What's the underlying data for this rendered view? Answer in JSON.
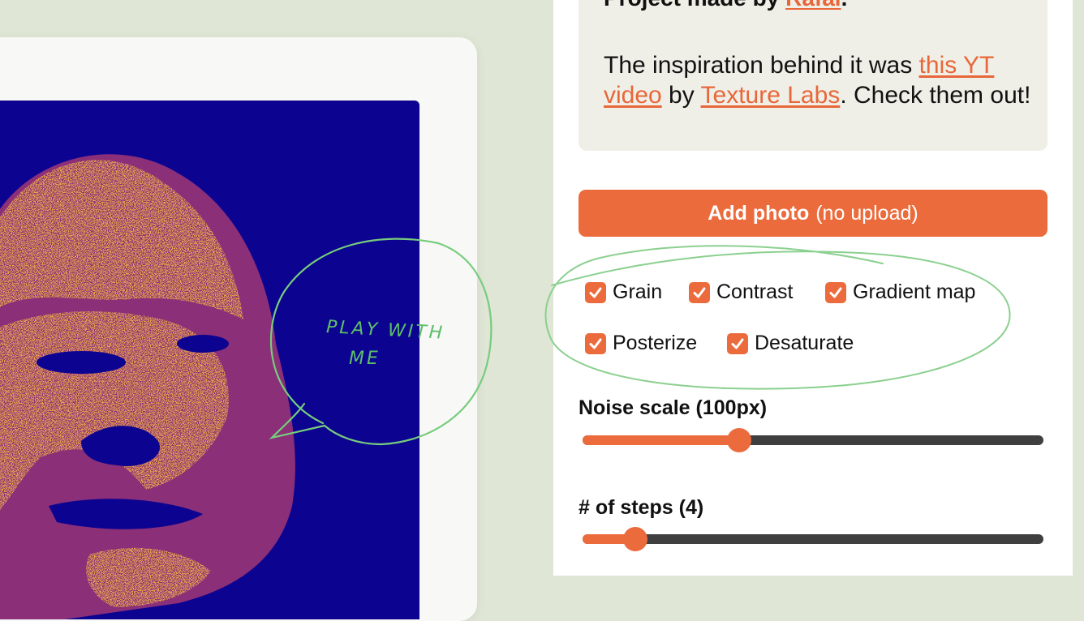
{
  "credits": {
    "title_prefix": "Project made by ",
    "author_link": "Rafal",
    "title_suffix": ".",
    "text_1": "The inspiration behind it was ",
    "video_link": "this YT video",
    "text_2": " by ",
    "labs_link": "Texture Labs",
    "text_3": ". Check them out!"
  },
  "add_photo": {
    "label": "Add photo",
    "sublabel": "(no upload)"
  },
  "effects": [
    {
      "label": "Grain",
      "checked": true
    },
    {
      "label": "Contrast",
      "checked": true
    },
    {
      "label": "Gradient map",
      "checked": true
    },
    {
      "label": "Posterize",
      "checked": true
    },
    {
      "label": "Desaturate",
      "checked": true
    }
  ],
  "noise_scale": {
    "label": "Noise scale (100px)",
    "fraction": 0.34
  },
  "steps": {
    "label": "# of steps (4)",
    "fraction": 0.115
  },
  "annotation": {
    "line1": "PLAY WITH",
    "line2": "ME"
  },
  "colors": {
    "accent": "#ec6b3c",
    "background": "#dfe6d6",
    "canvas_dark": "#0c0390",
    "canvas_mid": "#8a2f78",
    "canvas_light": "#e8a54e",
    "annotation": "#5dbf6a"
  }
}
